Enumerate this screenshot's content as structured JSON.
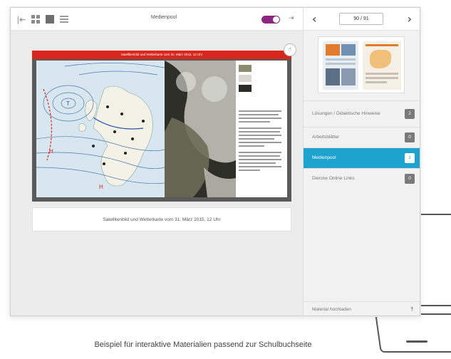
{
  "toolbar": {
    "title": "Medienpool",
    "collapse_icon": "collapse-left-icon",
    "expand_icon": "expand-right-icon"
  },
  "pager": {
    "page_indicator": "90 / 91"
  },
  "menu": {
    "items": [
      {
        "label": "Lösungen / Didaktische Hinweise",
        "badge": "2"
      },
      {
        "label": "Arbeitsblätter",
        "badge": "0"
      },
      {
        "label": "Medienpool",
        "badge": "1",
        "active": true
      },
      {
        "label": "Diercke Online Links",
        "badge": "0"
      }
    ],
    "upload_label": "Material hochladen"
  },
  "media": {
    "header": "Satellitenbild und Wetterkarte vom 31. März 2015, 12 Uhr",
    "caption": "Satellitenbild und Wetterkarte vom 31. März 2015, 12 Uhr"
  },
  "footer_caption": "Beispiel für interaktive Materialien passend zur Schulbuchseite",
  "colors": {
    "accent": "#1ea3cf",
    "toggle": "#8e2680",
    "header_red": "#d9271d"
  }
}
